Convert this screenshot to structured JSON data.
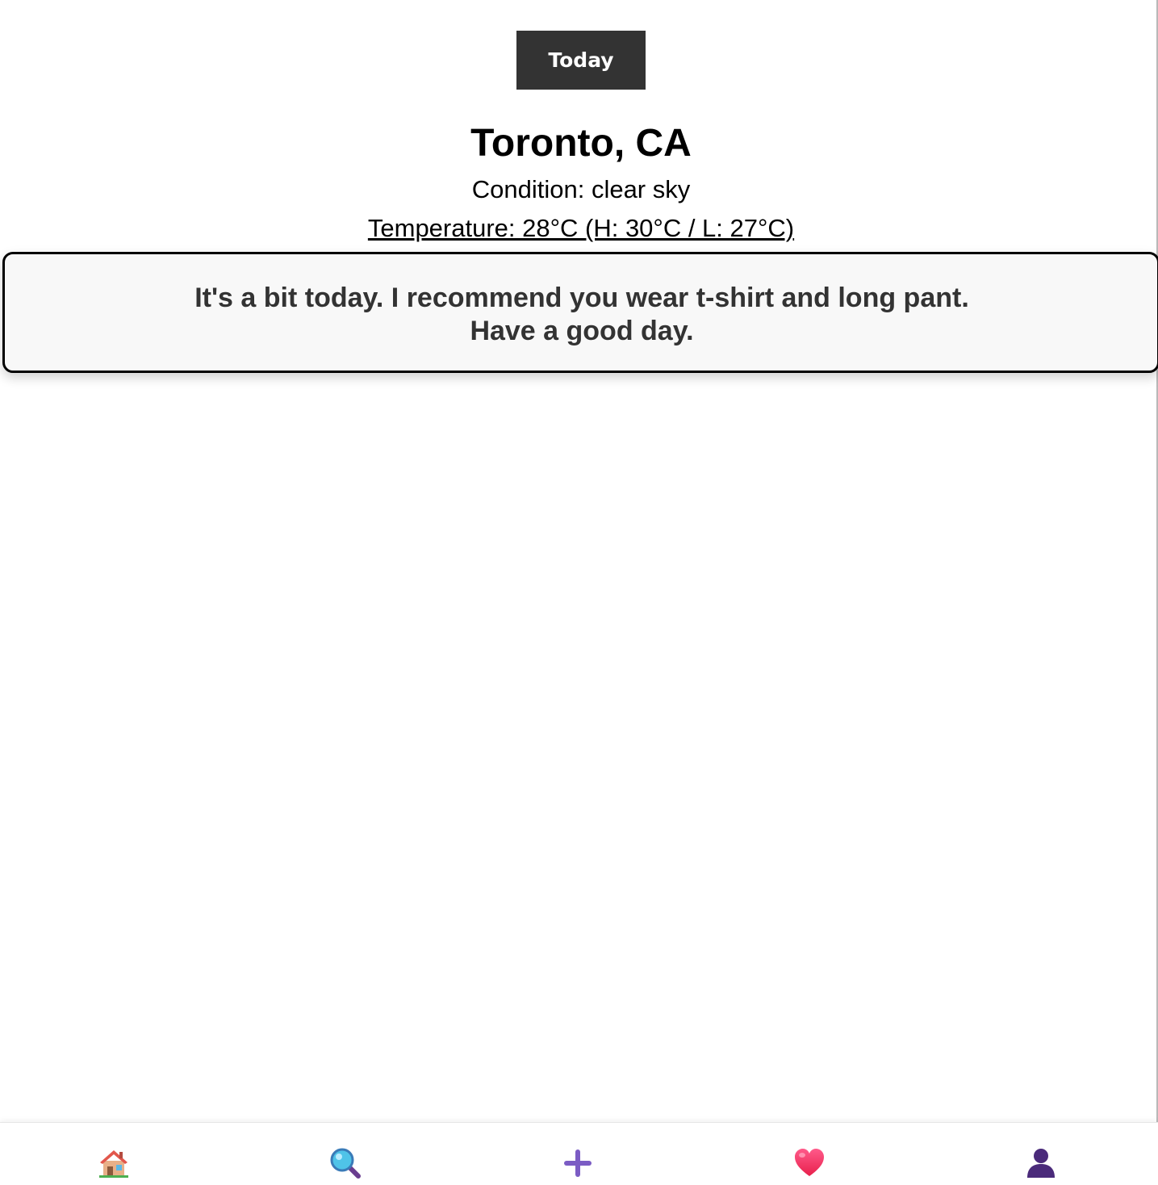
{
  "header": {
    "today_label": "Today"
  },
  "weather": {
    "city": "Toronto, CA",
    "condition": "Condition: clear sky",
    "temperature": "Temperature: 28°C (H: 30°C / L: 27°C)"
  },
  "advice": {
    "line1": "It's a bit today. I recommend you wear t-shirt and long pant.",
    "line2": "Have a good day."
  },
  "nav": {
    "items": [
      {
        "icon": "house-icon"
      },
      {
        "icon": "magnifying-glass-icon"
      },
      {
        "icon": "plus-icon"
      },
      {
        "icon": "heart-icon"
      },
      {
        "icon": "user-icon"
      }
    ]
  },
  "colors": {
    "button_bg": "#333333",
    "advice_text": "#333333",
    "advice_bg": "#f8f8f8",
    "plus": "#7b5cc4",
    "heart": "#f43b6b",
    "user": "#4a2a7a"
  }
}
